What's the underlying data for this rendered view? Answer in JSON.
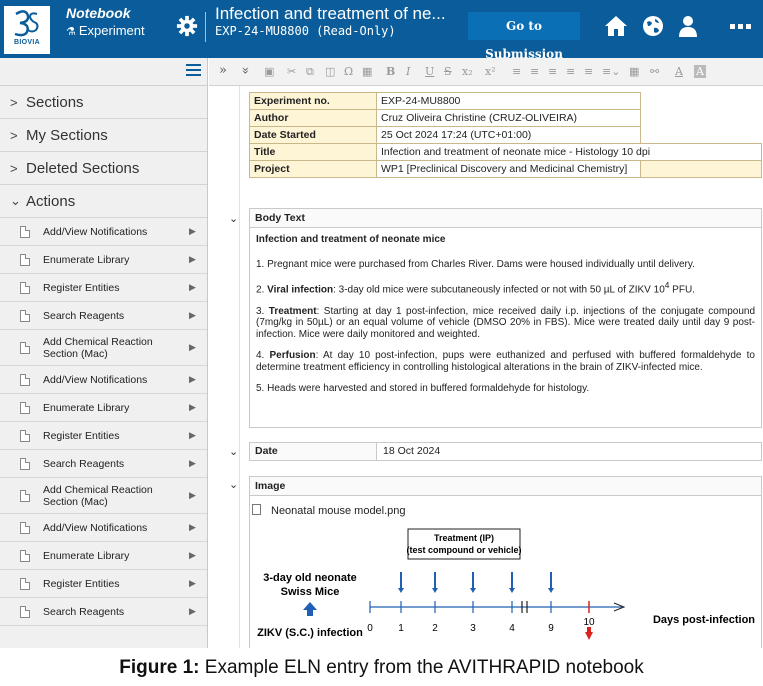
{
  "app": {
    "brand": "BIOVIA",
    "notebook_label": "Notebook",
    "experiment_label": "Experiment",
    "title": "Infection and treatment of ne...",
    "experiment_id": "EXP-24-MU8800 (Read-Only)",
    "go_button": "Go to Submission",
    "colors": {
      "header_bg": "#0a5d9a",
      "table_key_bg": "#fdf5d6"
    },
    "icons": [
      "home-icon",
      "globe-icon",
      "user-icon",
      "more-icon",
      "gear-icon"
    ]
  },
  "sidebar": {
    "sections": [
      {
        "chevron": ">",
        "label": "Sections"
      },
      {
        "chevron": ">",
        "label": "My Sections"
      },
      {
        "chevron": ">",
        "label": "Deleted Sections"
      },
      {
        "chevron": "⌄",
        "label": "Actions"
      }
    ],
    "items": [
      {
        "label": "Add/View Notifications"
      },
      {
        "label": "Enumerate Library"
      },
      {
        "label": "Register Entities"
      },
      {
        "label": "Search Reagents"
      },
      {
        "label": "Add Chemical Reaction Section (Mac)"
      },
      {
        "label": "Add/View Notifications"
      },
      {
        "label": "Enumerate Library"
      },
      {
        "label": "Register Entities"
      },
      {
        "label": "Search Reagents"
      },
      {
        "label": "Add Chemical Reaction Section (Mac)"
      },
      {
        "label": "Add/View Notifications"
      },
      {
        "label": "Enumerate Library"
      },
      {
        "label": "Register Entities"
      },
      {
        "label": "Search Reagents"
      }
    ]
  },
  "toolbar": {
    "expand": "»",
    "collapse": "»",
    "buttons": [
      "B",
      "I",
      "U",
      "S",
      "x₂",
      "x²"
    ]
  },
  "metadata": [
    {
      "key": "Experiment no.",
      "value": "EXP-24-MU8800"
    },
    {
      "key": "Author",
      "value": "Cruz Oliveira Christine (CRUZ-OLIVEIRA)"
    },
    {
      "key": "Date Started",
      "value": "25 Oct 2024 17:24 (UTC+01:00)"
    },
    {
      "key": "Title",
      "value": "Infection and treatment of neonate mice - Histology 10 dpi"
    },
    {
      "key": "Project",
      "value": "WP1 [Preclinical Discovery and Medicinal Chemistry]"
    }
  ],
  "body": {
    "header": "Body Text",
    "title": "Infection and treatment of neonate mice",
    "p1": "1. Pregnant mice were purchased from Charles River. Dams were housed individually until delivery.",
    "p2_bold": "Viral infection",
    "p2_pre": "2. ",
    "p2_rest": ": 3-day old mice were subcutaneously infected or not with 50 µL of ZIKV 10",
    "p2_sup": "4",
    "p2_end": " PFU.",
    "p3_pre": "3. ",
    "p3_bold": "Treatment",
    "p3_rest": ": Starting at day 1 post-infection, mice received daily i.p. injections of the conjugate compound (7mg/kg in 50µL) or an equal volume of vehicle (DMSO 20% in FBS). Mice were treated daily until day 9 post-infection. Mice were daily monitored and weighted.",
    "p4_pre": "4. ",
    "p4_bold": "Perfusion",
    "p4_rest": ": At day 10 post-infection, pups were euthanized and perfused with buffered formaldehyde to determine treatment efficiency in controlling histological alterations in the brain of ZIKV-infected mice.",
    "p5": "5. Heads were harvested and stored in buffered formaldehyde for histology."
  },
  "date_field": {
    "key": "Date",
    "value": "18 Oct 2024"
  },
  "image_section": {
    "header": "Image",
    "filename": "Neonatal mouse model.png",
    "treatment_line1": "Treatment (IP)",
    "treatment_line2": "(test compound or vehicle)",
    "mice_line1": "3-day old neonate",
    "mice_line2": "Swiss Mice",
    "infection": "ZIKV (S.C.) infection",
    "axis_label": "Days post-infection",
    "ticks": [
      "0",
      "1",
      "2",
      "3",
      "4",
      "9",
      "10"
    ]
  },
  "caption": {
    "bold": "Figure 1:",
    "text": " Example ELN entry from the AVITHRAPID notebook"
  }
}
